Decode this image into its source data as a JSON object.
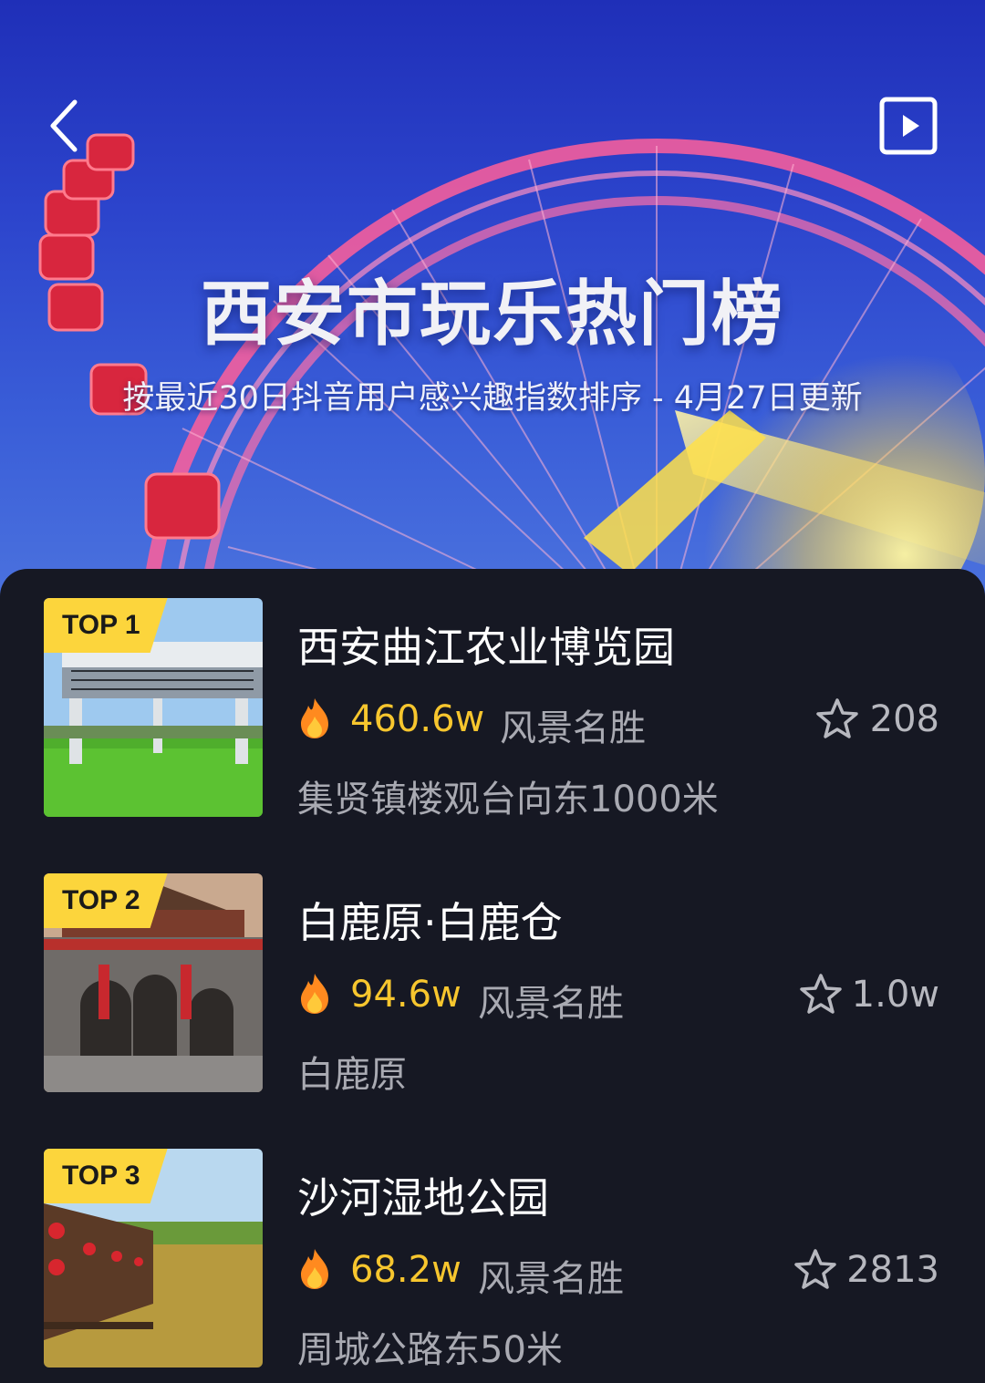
{
  "header": {
    "title": "西安市玩乐热门榜",
    "subtitle": "按最近30日抖音用户感兴趣指数排序 - 4月27日更新"
  },
  "colors": {
    "accent_yellow": "#fcd53c",
    "heat_text": "#f7c62e",
    "background": "#161823"
  },
  "icons": {
    "back": "chevron-left-icon",
    "play": "play-square-icon",
    "heat": "fire-icon",
    "favorite": "star-outline-icon"
  },
  "ranking": [
    {
      "badge": "TOP 1",
      "name": "西安曲江农业博览园",
      "heat": "460.6w",
      "category": "风景名胜",
      "favorites": "208",
      "address": "集贤镇楼观台向东1000米"
    },
    {
      "badge": "TOP 2",
      "name": "白鹿原·白鹿仓",
      "heat": "94.6w",
      "category": "风景名胜",
      "favorites": "1.0w",
      "address": "白鹿原"
    },
    {
      "badge": "TOP 3",
      "name": "沙河湿地公园",
      "heat": "68.2w",
      "category": "风景名胜",
      "favorites": "2813",
      "address": "周城公路东50米"
    }
  ]
}
